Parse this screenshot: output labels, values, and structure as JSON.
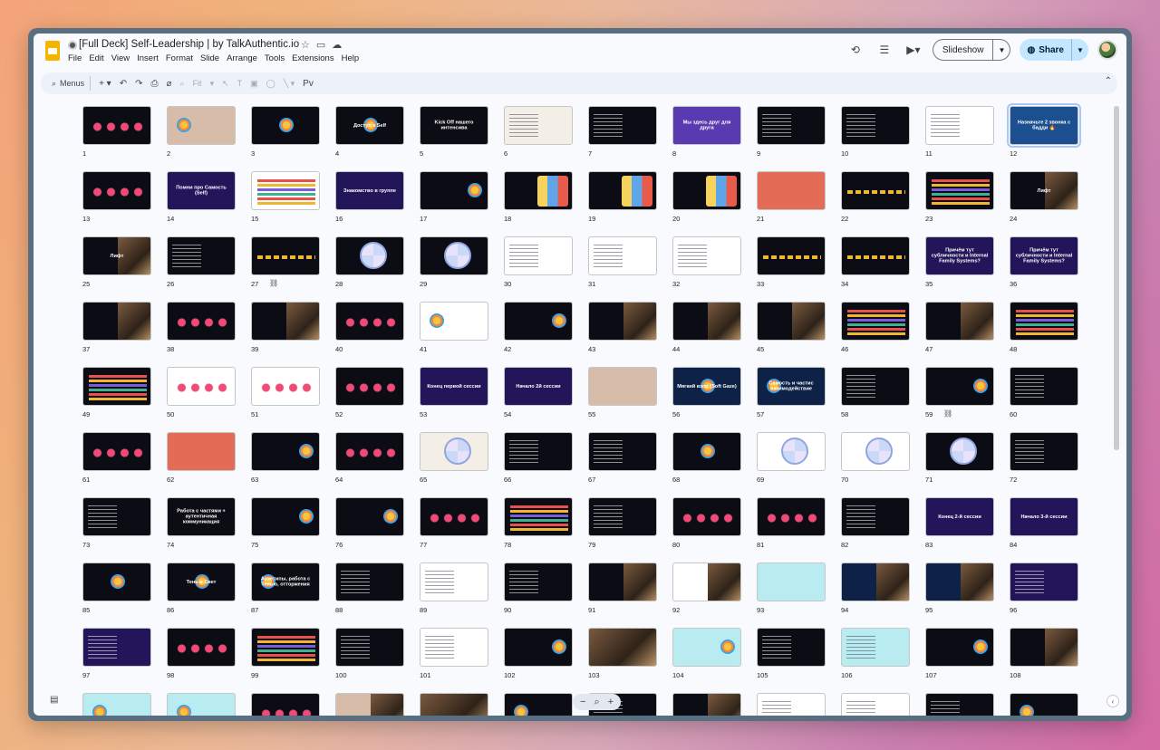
{
  "window": {
    "doc_title": "[Full Deck] Self-Leadership | by TalkAuthentic.io",
    "menu": [
      "File",
      "Edit",
      "View",
      "Insert",
      "Format",
      "Slide",
      "Arrange",
      "Tools",
      "Extensions",
      "Help"
    ],
    "slideshow_label": "Slideshow",
    "share_label": "Share"
  },
  "toolbar": {
    "menus_label": "Menus",
    "fit_label": "Fit"
  },
  "slides": [
    {
      "n": "1",
      "theme": "dark",
      "deco": "dots",
      "text": ""
    },
    {
      "n": "2",
      "theme": "beige",
      "deco": "circle-left",
      "text": ""
    },
    {
      "n": "3",
      "theme": "dark",
      "deco": "circle",
      "text": ""
    },
    {
      "n": "4",
      "theme": "dark",
      "deco": "circle",
      "text": "Доступ к Self"
    },
    {
      "n": "5",
      "theme": "dark",
      "deco": "",
      "text": "Kick Off нашего интенсива"
    },
    {
      "n": "6",
      "theme": "light",
      "deco": "lines-dark",
      "text": ""
    },
    {
      "n": "7",
      "theme": "dark",
      "deco": "lines",
      "text": ""
    },
    {
      "n": "8",
      "theme": "violet",
      "deco": "",
      "text": "Мы здесь друг для друга"
    },
    {
      "n": "9",
      "theme": "dark",
      "deco": "lines",
      "text": ""
    },
    {
      "n": "10",
      "theme": "dark",
      "deco": "lines",
      "text": ""
    },
    {
      "n": "11",
      "theme": "white",
      "deco": "lines-dark",
      "text": ""
    },
    {
      "n": "12",
      "theme": "blue",
      "deco": "",
      "text": "Назначьте 2 звонка с бадди 🔥",
      "selected": true
    },
    {
      "n": "13",
      "theme": "dark",
      "deco": "dots",
      "text": ""
    },
    {
      "n": "14",
      "theme": "purple",
      "deco": "",
      "text": "Помни про Самость (Self)"
    },
    {
      "n": "15",
      "theme": "white",
      "deco": "bars",
      "text": ""
    },
    {
      "n": "16",
      "theme": "purple",
      "deco": "",
      "text": "Знакомство в группе"
    },
    {
      "n": "17",
      "theme": "dark",
      "deco": "circle-right",
      "text": ""
    },
    {
      "n": "18",
      "theme": "dark",
      "deco": "cards",
      "text": ""
    },
    {
      "n": "19",
      "theme": "dark",
      "deco": "cards",
      "text": ""
    },
    {
      "n": "20",
      "theme": "dark",
      "deco": "cards",
      "text": ""
    },
    {
      "n": "21",
      "theme": "coral",
      "deco": "",
      "text": ""
    },
    {
      "n": "22",
      "theme": "dark",
      "deco": "wave",
      "text": ""
    },
    {
      "n": "23",
      "theme": "dark",
      "deco": "bars",
      "text": ""
    },
    {
      "n": "24",
      "theme": "dark",
      "deco": "photo-half",
      "text": "Лифт"
    },
    {
      "n": "25",
      "theme": "dark",
      "deco": "photo-half",
      "text": "Лифт"
    },
    {
      "n": "26",
      "theme": "dark",
      "deco": "lines",
      "text": ""
    },
    {
      "n": "27",
      "theme": "dark",
      "deco": "wave",
      "text": "",
      "link": true
    },
    {
      "n": "28",
      "theme": "dark",
      "deco": "wheel",
      "text": ""
    },
    {
      "n": "29",
      "theme": "dark",
      "deco": "wheel",
      "text": ""
    },
    {
      "n": "30",
      "theme": "white",
      "deco": "lines-dark",
      "text": ""
    },
    {
      "n": "31",
      "theme": "white",
      "deco": "lines-dark",
      "text": ""
    },
    {
      "n": "32",
      "theme": "white",
      "deco": "lines-dark",
      "text": ""
    },
    {
      "n": "33",
      "theme": "dark",
      "deco": "wave",
      "text": ""
    },
    {
      "n": "34",
      "theme": "dark",
      "deco": "wave",
      "text": ""
    },
    {
      "n": "35",
      "theme": "purple",
      "deco": "",
      "text": "Причём тут субличности и Internal Family Systems?"
    },
    {
      "n": "36",
      "theme": "purple",
      "deco": "",
      "text": "Причём тут субличности и Internal Family Systems?"
    },
    {
      "n": "37",
      "theme": "dark",
      "deco": "photo-half",
      "text": ""
    },
    {
      "n": "38",
      "theme": "dark",
      "deco": "dots",
      "text": ""
    },
    {
      "n": "39",
      "theme": "dark",
      "deco": "photo-half",
      "text": ""
    },
    {
      "n": "40",
      "theme": "dark",
      "deco": "dots",
      "text": ""
    },
    {
      "n": "41",
      "theme": "white",
      "deco": "circle-left",
      "text": ""
    },
    {
      "n": "42",
      "theme": "dark",
      "deco": "circle-right",
      "text": ""
    },
    {
      "n": "43",
      "theme": "dark",
      "deco": "photo-half",
      "text": ""
    },
    {
      "n": "44",
      "theme": "dark",
      "deco": "photo-half",
      "text": ""
    },
    {
      "n": "45",
      "theme": "dark",
      "deco": "photo-half",
      "text": ""
    },
    {
      "n": "46",
      "theme": "dark",
      "deco": "bars",
      "text": ""
    },
    {
      "n": "47",
      "theme": "dark",
      "deco": "photo-half",
      "text": ""
    },
    {
      "n": "48",
      "theme": "dark",
      "deco": "bars",
      "text": ""
    },
    {
      "n": "49",
      "theme": "dark",
      "deco": "bars",
      "text": ""
    },
    {
      "n": "50",
      "theme": "white",
      "deco": "dots",
      "text": ""
    },
    {
      "n": "51",
      "theme": "white",
      "deco": "dots",
      "text": ""
    },
    {
      "n": "52",
      "theme": "dark",
      "deco": "dots",
      "text": ""
    },
    {
      "n": "53",
      "theme": "purple",
      "deco": "",
      "text": "Конец первой сессии"
    },
    {
      "n": "54",
      "theme": "purple",
      "deco": "",
      "text": "Начало 2й сессии"
    },
    {
      "n": "55",
      "theme": "beige",
      "deco": "",
      "text": ""
    },
    {
      "n": "56",
      "theme": "navy",
      "deco": "circle",
      "text": "Мягкий взор (Soft Gaze)"
    },
    {
      "n": "57",
      "theme": "navy",
      "deco": "circle-left",
      "text": "Самость и частис взаимодействие"
    },
    {
      "n": "58",
      "theme": "dark",
      "deco": "lines",
      "text": ""
    },
    {
      "n": "59",
      "theme": "dark",
      "deco": "circle-right",
      "text": "",
      "link": true
    },
    {
      "n": "60",
      "theme": "dark",
      "deco": "lines",
      "text": ""
    },
    {
      "n": "61",
      "theme": "dark",
      "deco": "dots",
      "text": ""
    },
    {
      "n": "62",
      "theme": "coral",
      "deco": "",
      "text": ""
    },
    {
      "n": "63",
      "theme": "dark",
      "deco": "circle-right",
      "text": ""
    },
    {
      "n": "64",
      "theme": "dark",
      "deco": "dots",
      "text": ""
    },
    {
      "n": "65",
      "theme": "light",
      "deco": "wheel",
      "text": ""
    },
    {
      "n": "66",
      "theme": "dark",
      "deco": "lines",
      "text": ""
    },
    {
      "n": "67",
      "theme": "dark",
      "deco": "lines",
      "text": ""
    },
    {
      "n": "68",
      "theme": "dark",
      "deco": "circle",
      "text": ""
    },
    {
      "n": "69",
      "theme": "white",
      "deco": "wheel",
      "text": ""
    },
    {
      "n": "70",
      "theme": "white",
      "deco": "wheel",
      "text": ""
    },
    {
      "n": "71",
      "theme": "dark",
      "deco": "wheel",
      "text": ""
    },
    {
      "n": "72",
      "theme": "dark",
      "deco": "lines",
      "text": ""
    },
    {
      "n": "73",
      "theme": "dark",
      "deco": "lines",
      "text": ""
    },
    {
      "n": "74",
      "theme": "dark",
      "deco": "",
      "text": "Работа с частями + аутентичная коммуникация"
    },
    {
      "n": "75",
      "theme": "dark",
      "deco": "circle-right",
      "text": ""
    },
    {
      "n": "76",
      "theme": "dark",
      "deco": "circle-right",
      "text": ""
    },
    {
      "n": "77",
      "theme": "dark",
      "deco": "dots",
      "text": ""
    },
    {
      "n": "78",
      "theme": "dark",
      "deco": "bars",
      "text": ""
    },
    {
      "n": "79",
      "theme": "dark",
      "deco": "lines",
      "text": ""
    },
    {
      "n": "80",
      "theme": "dark",
      "deco": "dots",
      "text": ""
    },
    {
      "n": "81",
      "theme": "dark",
      "deco": "dots",
      "text": ""
    },
    {
      "n": "82",
      "theme": "dark",
      "deco": "lines",
      "text": ""
    },
    {
      "n": "83",
      "theme": "purple",
      "deco": "",
      "text": "Конец 2-й сессии"
    },
    {
      "n": "84",
      "theme": "purple",
      "deco": "",
      "text": "Начало 3-й сессии"
    },
    {
      "n": "85",
      "theme": "dark",
      "deco": "circle",
      "text": ""
    },
    {
      "n": "86",
      "theme": "dark",
      "deco": "circle",
      "text": "Тень и Свет"
    },
    {
      "n": "87",
      "theme": "dark",
      "deco": "circle-left",
      "text": "Архетипы, работа с Тенью, отторжения"
    },
    {
      "n": "88",
      "theme": "dark",
      "deco": "lines",
      "text": ""
    },
    {
      "n": "89",
      "theme": "white",
      "deco": "lines-dark",
      "text": ""
    },
    {
      "n": "90",
      "theme": "dark",
      "deco": "lines",
      "text": ""
    },
    {
      "n": "91",
      "theme": "dark",
      "deco": "photo-half",
      "text": ""
    },
    {
      "n": "92",
      "theme": "white",
      "deco": "photo-half",
      "text": ""
    },
    {
      "n": "93",
      "theme": "lightblue",
      "deco": "",
      "text": ""
    },
    {
      "n": "94",
      "theme": "navy",
      "deco": "photo-half",
      "text": ""
    },
    {
      "n": "95",
      "theme": "navy",
      "deco": "photo-half",
      "text": ""
    },
    {
      "n": "96",
      "theme": "purple",
      "deco": "lines",
      "text": ""
    },
    {
      "n": "97",
      "theme": "purple",
      "deco": "lines",
      "text": ""
    },
    {
      "n": "98",
      "theme": "dark",
      "deco": "dots",
      "text": ""
    },
    {
      "n": "99",
      "theme": "dark",
      "deco": "bars",
      "text": ""
    },
    {
      "n": "100",
      "theme": "dark",
      "deco": "lines",
      "text": ""
    },
    {
      "n": "101",
      "theme": "white",
      "deco": "lines-dark",
      "text": ""
    },
    {
      "n": "102",
      "theme": "dark",
      "deco": "circle-right",
      "text": ""
    },
    {
      "n": "103",
      "theme": "lightblue",
      "deco": "photo",
      "text": ""
    },
    {
      "n": "104",
      "theme": "lightblue",
      "deco": "circle-right",
      "text": ""
    },
    {
      "n": "105",
      "theme": "dark",
      "deco": "lines",
      "text": ""
    },
    {
      "n": "106",
      "theme": "lightblue",
      "deco": "lines-dark",
      "text": ""
    },
    {
      "n": "107",
      "theme": "dark",
      "deco": "circle-right",
      "text": ""
    },
    {
      "n": "108",
      "theme": "dark",
      "deco": "photo-half",
      "text": ""
    },
    {
      "n": "",
      "theme": "lightblue",
      "deco": "circle-left",
      "text": ""
    },
    {
      "n": "",
      "theme": "lightblue",
      "deco": "circle-left",
      "text": ""
    },
    {
      "n": "",
      "theme": "dark",
      "deco": "dots",
      "text": ""
    },
    {
      "n": "",
      "theme": "beige",
      "deco": "photo-half",
      "text": ""
    },
    {
      "n": "",
      "theme": "dark",
      "deco": "photo",
      "text": ""
    },
    {
      "n": "",
      "theme": "dark",
      "deco": "circle-left",
      "text": ""
    },
    {
      "n": "",
      "theme": "dark",
      "deco": "lines",
      "text": ""
    },
    {
      "n": "",
      "theme": "dark",
      "deco": "photo-half",
      "text": ""
    },
    {
      "n": "",
      "theme": "white",
      "deco": "lines-dark",
      "text": ""
    },
    {
      "n": "",
      "theme": "white",
      "deco": "lines-dark",
      "text": ""
    },
    {
      "n": "",
      "theme": "dark",
      "deco": "lines",
      "text": ""
    },
    {
      "n": "",
      "theme": "dark",
      "deco": "circle-left",
      "text": ""
    }
  ]
}
